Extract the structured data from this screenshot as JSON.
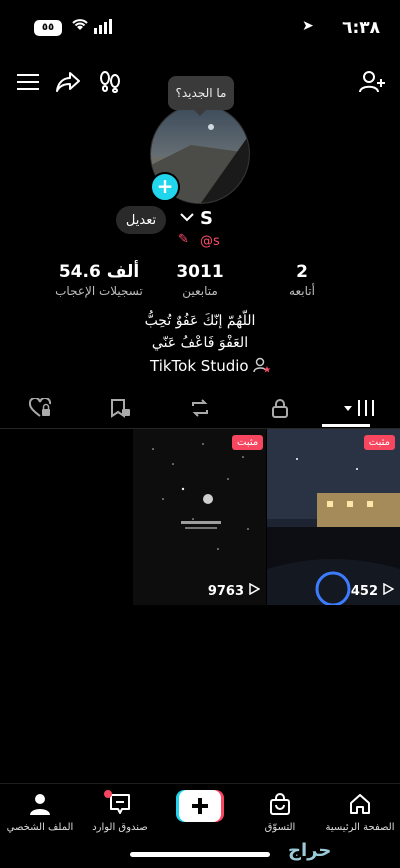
{
  "status_bar": {
    "time": "٦:٣٨",
    "battery": "٥٥"
  },
  "header": {
    "bubble_text": "ما الجديد؟"
  },
  "profile": {
    "edit_label": "تعديل",
    "name": "S",
    "handle": "@s",
    "stats": [
      {
        "value": "2",
        "label": "أتابعه"
      },
      {
        "value": "3011",
        "label": "متابعين"
      },
      {
        "value": "54.6 ألف",
        "label": "تسجيلات الإعجاب"
      }
    ],
    "bio_line1": "اللّهُمّ إنّكَ عَفُوٌ تُحِبُّ",
    "bio_line2": "العَفْوَ فَاعْفُ عَنّي",
    "studio_label": "TikTok Studio"
  },
  "videos": [
    {
      "pinned_label": "مثبت",
      "views": "452"
    },
    {
      "pinned_label": "مثبت",
      "views": "9763"
    }
  ],
  "bottom_nav": {
    "home": "الصفحة الرئيسية",
    "shop": "التسوّق",
    "inbox": "صندوق الوارد",
    "profile": "الملف الشخصي"
  },
  "watermark": "حراج",
  "colors": {
    "accent": "#f7465f",
    "plus": "#20d5ec",
    "handle": "#ff4d6d"
  }
}
